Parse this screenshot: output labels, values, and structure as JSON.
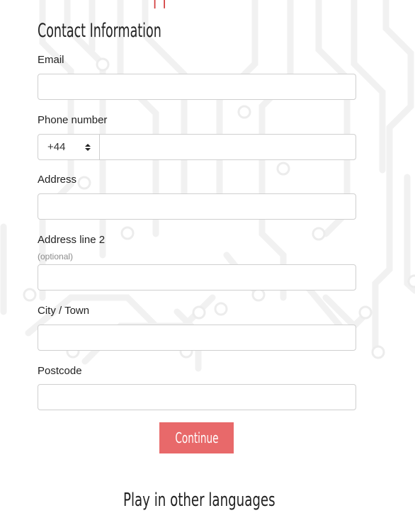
{
  "brand": {
    "logo_text": "IT ROXY",
    "accent_color": "#e8696a"
  },
  "form": {
    "title": "Contact Information",
    "email": {
      "label": "Email",
      "value": "",
      "placeholder": ""
    },
    "phone": {
      "label": "Phone number",
      "country_code": "+44",
      "value": "",
      "placeholder": ""
    },
    "address": {
      "label": "Address",
      "value": "",
      "placeholder": ""
    },
    "address2": {
      "label": "Address line 2",
      "hint": "(optional)",
      "value": "",
      "placeholder": ""
    },
    "city": {
      "label": "City / Town",
      "value": "",
      "placeholder": ""
    },
    "postcode": {
      "label": "Postcode",
      "value": "",
      "placeholder": ""
    },
    "submit_label": "Continue"
  },
  "footer": {
    "languages_heading": "Play in other languages"
  },
  "icons": {
    "select_arrows": "sort-arrows-icon"
  }
}
